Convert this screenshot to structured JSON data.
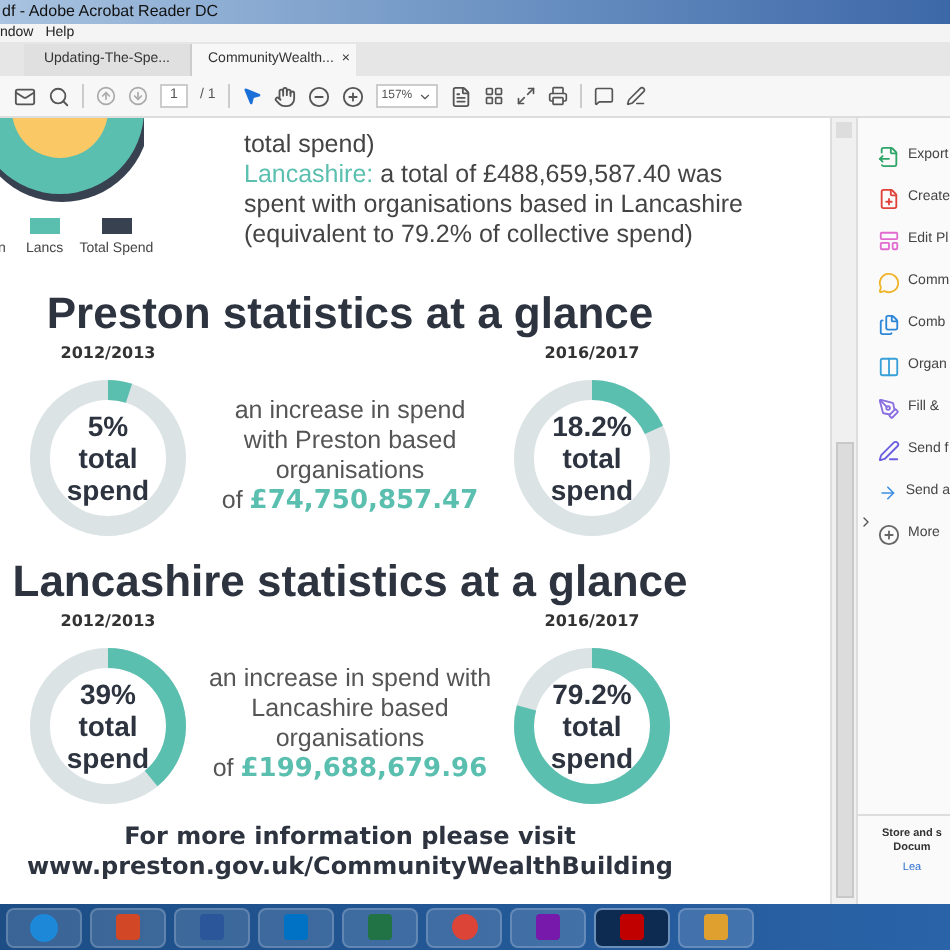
{
  "window": {
    "title": "df - Adobe Acrobat Reader DC"
  },
  "menu": [
    "ndow",
    "Help"
  ],
  "tabs": [
    {
      "label": "Updating-The-Spe...",
      "selected": false
    },
    {
      "label": "CommunityWealth...",
      "selected": true,
      "close": "×"
    }
  ],
  "toolbar": {
    "page": "1",
    "page_total": "/ 1",
    "zoom": "157%"
  },
  "document": {
    "legend": [
      {
        "label": "n"
      },
      {
        "label": "Lancs",
        "color": "#5bbfb0"
      },
      {
        "label": "Total Spend",
        "color": "#374150"
      }
    ],
    "intro_tail": "total spend)",
    "intro": {
      "label": "Lancashire:",
      "text": "a total of £488,659,587.40 was spent with organisations based in Lancashire (equivalent to 79.2% of collective spend)"
    },
    "sections": [
      {
        "title": "Preston statistics at a glance",
        "before": {
          "year": "2012/2013",
          "level": 0.05,
          "lines": [
            "5%",
            "total",
            "spend"
          ]
        },
        "middle": {
          "lines": [
            "an increase in spend",
            "with Preston based",
            "organisations"
          ],
          "of": "of",
          "amount": "£74,750,857.47"
        },
        "after": {
          "year": "2016/2017",
          "level": 0.182,
          "lines": [
            "18.2%",
            "total",
            "spend"
          ]
        }
      },
      {
        "title": "Lancashire statistics at a glance",
        "before": {
          "year": "2012/2013",
          "level": 0.39,
          "lines": [
            "39%",
            "total",
            "spend"
          ]
        },
        "middle": {
          "lines": [
            "an increase in spend with",
            "Lancashire based",
            "organisations"
          ],
          "of": "of",
          "amount": "£199,688,679.96"
        },
        "after": {
          "year": "2016/2017",
          "level": 0.792,
          "lines": [
            "79.2%",
            "total",
            "spend"
          ]
        }
      }
    ],
    "footer": [
      "For more information please visit",
      "www.preston.gov.uk/CommunityWealthBuilding"
    ]
  },
  "tools": [
    {
      "kind": "export",
      "label": "Export"
    },
    {
      "kind": "create",
      "label": "Create"
    },
    {
      "kind": "edit",
      "label": "Edit Pl"
    },
    {
      "kind": "comment",
      "label": "Comm"
    },
    {
      "kind": "combine",
      "label": "Comb"
    },
    {
      "kind": "organize",
      "label": "Organ"
    },
    {
      "kind": "fill",
      "label": "Fill &"
    },
    {
      "kind": "sign",
      "label": "Send f"
    },
    {
      "kind": "send",
      "label": "Send a"
    },
    {
      "kind": "more",
      "label": "More"
    }
  ],
  "promo": {
    "title": "Store and s",
    "subtitle": "Docum",
    "link": "Lea"
  },
  "taskbar": [
    {
      "kind": "start",
      "color": "#1e88d8",
      "selected": false
    },
    {
      "kind": "slides",
      "color": "#d24726",
      "selected": false
    },
    {
      "kind": "doc",
      "color": "#2b579a",
      "selected": false
    },
    {
      "kind": "mail",
      "color": "#0072c6",
      "selected": false
    },
    {
      "kind": "sheet",
      "color": "#217346",
      "selected": false
    },
    {
      "kind": "browser",
      "color": "#db4437",
      "selected": false
    },
    {
      "kind": "notes",
      "color": "#7719aa",
      "selected": false
    },
    {
      "kind": "pdf",
      "color": "#c00000",
      "selected": true
    },
    {
      "kind": "paint",
      "color": "#e0a030",
      "selected": false
    }
  ]
}
